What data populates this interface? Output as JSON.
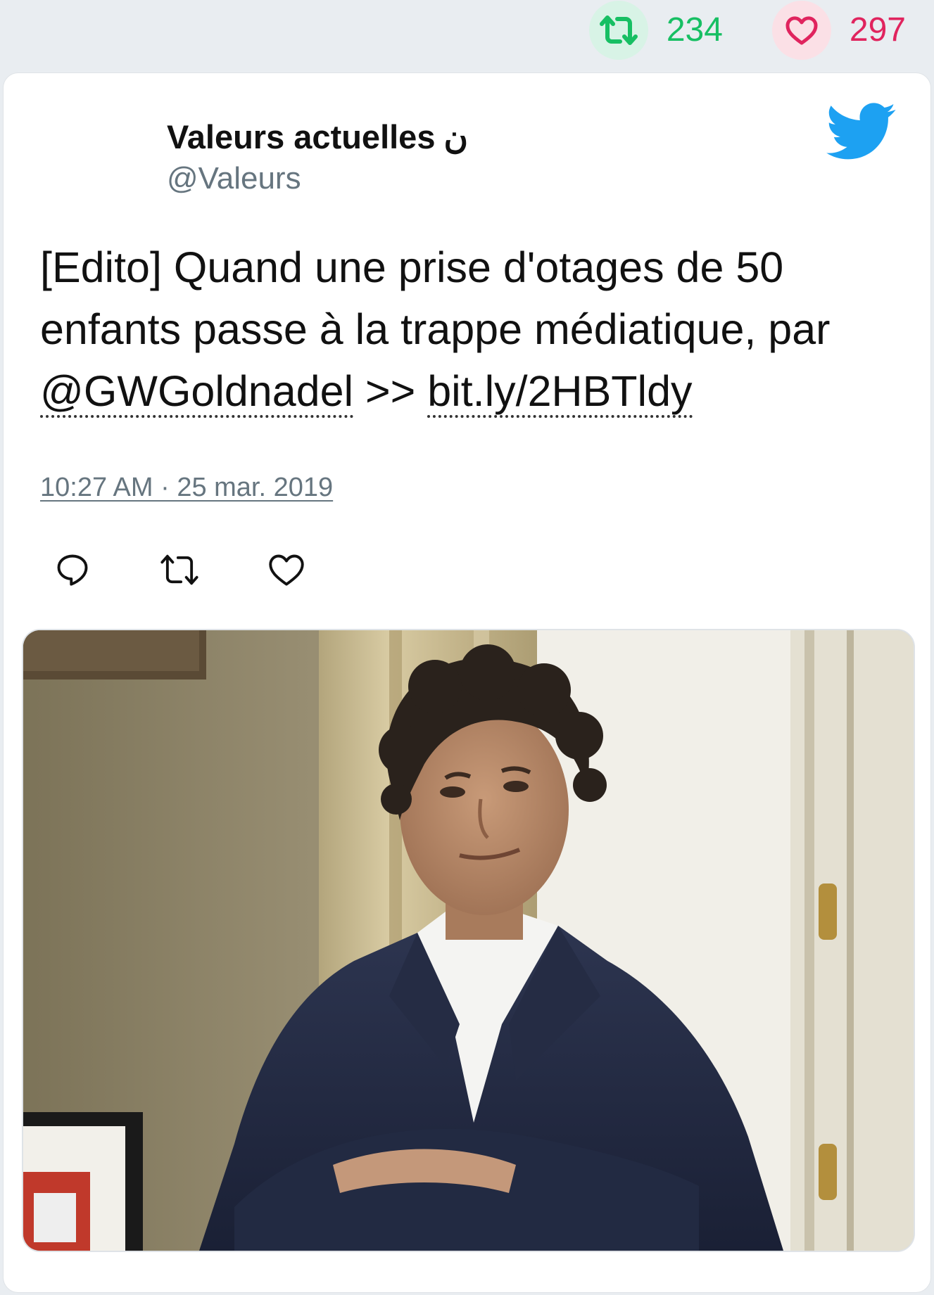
{
  "stats": {
    "retweets": "234",
    "likes": "297"
  },
  "tweet": {
    "author_name": "Valeurs actuelles",
    "author_glyph": "ن",
    "handle": "@Valeurs",
    "text_lead": "[Edito] Quand une prise d'otages de 50 enfants passe à la trappe médiatique, par ",
    "mention": "@GWGoldnadel",
    "separator": " >> ",
    "link": "bit.ly/2HBTldy",
    "timestamp": "10:27 AM · 25 mar. 2019"
  },
  "icons": {
    "retweet_stat": "retweet-icon",
    "like_stat": "heart-icon",
    "brand": "twitter-bird-icon",
    "reply": "reply-icon",
    "retweet": "retweet-icon",
    "like": "heart-icon"
  },
  "colors": {
    "retweet_green": "#17bf63",
    "like_pink": "#e0245e",
    "twitter_blue": "#1da1f2",
    "meta_gray": "#66757f",
    "page_bg": "#e9edf1"
  }
}
